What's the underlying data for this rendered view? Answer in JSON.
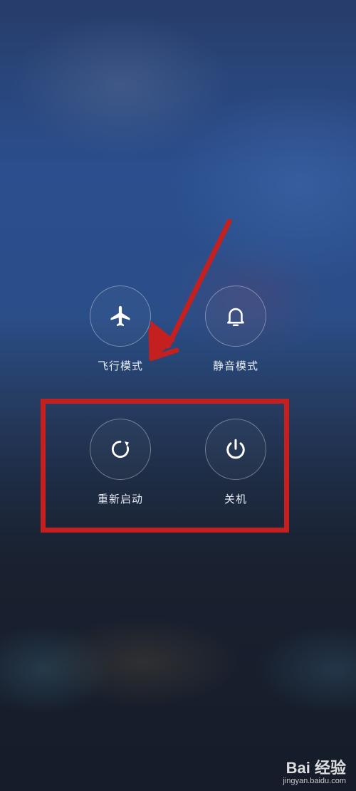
{
  "power_menu": {
    "airplane_mode": {
      "label": "飞行模式",
      "icon": "airplane-icon"
    },
    "silent_mode": {
      "label": "静音模式",
      "icon": "bell-icon"
    },
    "restart": {
      "label": "重新启动",
      "icon": "restart-icon"
    },
    "power_off": {
      "label": "关机",
      "icon": "power-icon"
    }
  },
  "annotation": {
    "color": "#c4201f"
  },
  "watermark": {
    "brand": "Bai  经验",
    "url": "jingyan.baidu.com"
  }
}
